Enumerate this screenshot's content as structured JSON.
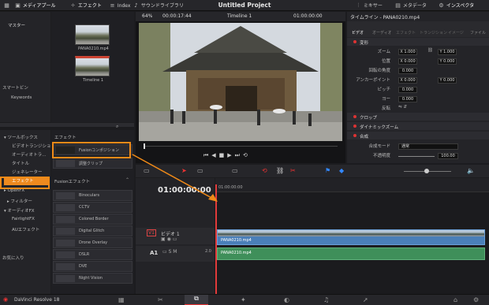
{
  "topbar": {
    "media_pool": "メディアプール",
    "effects": "エフェクト",
    "index": "Index",
    "sound_library": "サウンドライブラリ",
    "project_title": "Untitled Project",
    "mixer": "ミキサー",
    "metadata": "メタデータ",
    "inspector": "インスペクタ"
  },
  "viewer_bar": {
    "zoom": "64%",
    "src_tc": "00:00:17:44",
    "timeline_name": "Timeline 1",
    "rec_tc": "01:00:00:00",
    "inspector_title": "タイムライン - PANA0210.mp4"
  },
  "media": {
    "bin": "マスター",
    "smart_bins": "スマートビン",
    "keywords": "Keywords",
    "clips": [
      {
        "name": "PANA0210.mp4"
      },
      {
        "name": "Timeline 1"
      }
    ]
  },
  "effects_sidebar": {
    "items": [
      "ツールボックス",
      "ビデオトランジション",
      "オーディオトラ…",
      "タイトル",
      "ジェネレーター",
      "エフェクト",
      "OpenFX",
      "フィルター",
      "オーディオFX",
      "FairlightFX",
      "AUエフェクト"
    ],
    "favorites": "お気に入り"
  },
  "effects_list": {
    "header": "エフェクト",
    "items": [
      "Fusionコンポジション",
      "調整クリップ"
    ],
    "fusion_header": "Fusionエフェクト",
    "fusion_items": [
      "Binoculars",
      "CCTV",
      "Colored Border",
      "Digital Glitch",
      "Drone Overlay",
      "DSLR",
      "DVE",
      "Night Vision"
    ]
  },
  "inspector": {
    "tabs": [
      "ビデオ",
      "オーディオ",
      "エフェクト",
      "トランジション",
      "イメージ",
      "ファイル"
    ],
    "transform": "変形",
    "rows": [
      {
        "label": "ズーム",
        "x": "X 1.000",
        "y": "Y 1.000"
      },
      {
        "label": "位置",
        "x": "X 0.000",
        "y": "Y 0.000"
      },
      {
        "label": "回転の角度",
        "x": "0.000"
      },
      {
        "label": "アンカーポイント",
        "x": "X 0.000",
        "y": "Y 0.000"
      },
      {
        "label": "ピッチ",
        "x": "0.000"
      },
      {
        "label": "ヨー",
        "x": "0.000"
      },
      {
        "label": "反転",
        "x": ""
      }
    ],
    "crop": "クロップ",
    "dynamic_zoom": "ダイナミックズーム",
    "composite": "合成",
    "composite_mode_label": "合成モード",
    "composite_mode": "通常",
    "opacity_label": "不透明度",
    "opacity": "100.00"
  },
  "timeline": {
    "timecode": "01:00:00:00",
    "ruler_tc": "01:00:00:00",
    "video_track": {
      "id": "V1",
      "name": "ビデオ 1",
      "clip": "PANA0210.mp4"
    },
    "audio_track": {
      "id": "A1",
      "level": "2.0",
      "clip": "PANA0210.mp4"
    }
  },
  "bottombar": {
    "app": "DaVinci Resolve 18"
  },
  "colors": {
    "accent": "#ee8a1f",
    "playhead": "#e23b3b",
    "video_clip": "#4a7fb8",
    "audio_clip": "#3f8f5a"
  }
}
